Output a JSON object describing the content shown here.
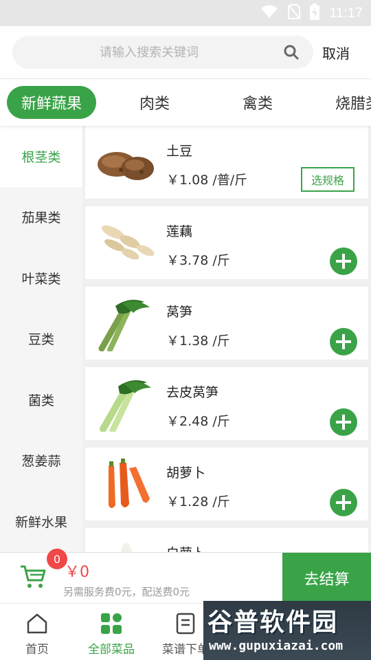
{
  "status_bar": {
    "time": "11:17"
  },
  "search": {
    "placeholder": "请输入搜索关键词",
    "cancel_label": "取消"
  },
  "tabs": [
    {
      "label": "新鲜蔬果",
      "active": true
    },
    {
      "label": "肉类"
    },
    {
      "label": "禽类"
    },
    {
      "label": "烧腊类"
    }
  ],
  "side_categories": [
    {
      "label": "根茎类",
      "active": true
    },
    {
      "label": "茄果类"
    },
    {
      "label": "叶菜类"
    },
    {
      "label": "豆类"
    },
    {
      "label": "菌类"
    },
    {
      "label": "葱姜蒜"
    },
    {
      "label": "新鲜水果"
    }
  ],
  "products": [
    {
      "name": "土豆",
      "price": "￥1.08 /普/斤",
      "action": "选规格",
      "image": "potato"
    },
    {
      "name": "莲藕",
      "price": "￥3.78 /斤",
      "image": "lotus-root"
    },
    {
      "name": "莴笋",
      "price": "￥1.38 /斤",
      "image": "celtuce"
    },
    {
      "name": "去皮莴笋",
      "price": "￥2.48 /斤",
      "image": "peeled-celtuce"
    },
    {
      "name": "胡萝卜",
      "price": "￥1.28 /斤",
      "image": "carrot"
    },
    {
      "name": "白萝卜",
      "image": "white-radish"
    }
  ],
  "cart": {
    "count": "0",
    "amount": "￥0",
    "fees": "另需服务费0元，配送费0元",
    "checkout_label": "去结算"
  },
  "nav": [
    {
      "label": "首页",
      "icon": "home-icon"
    },
    {
      "label": "全部菜品",
      "icon": "grid-icon",
      "active": true
    },
    {
      "label": "菜谱下单",
      "icon": "recipe-icon"
    }
  ],
  "watermark": {
    "title": "谷普软件园",
    "url": "www.gupuxiazai.com"
  },
  "colors": {
    "accent": "#3aa348",
    "price_red": "#f04848"
  }
}
